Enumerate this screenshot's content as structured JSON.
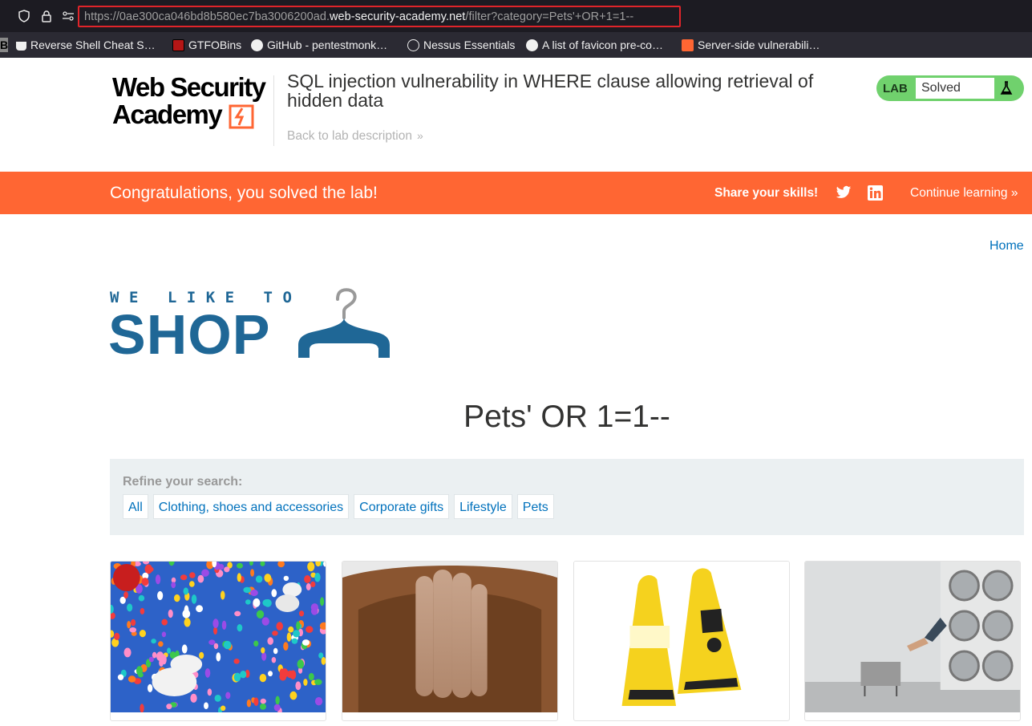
{
  "browser": {
    "url_prefix": "https://0ae300ca046bd8b580ec7ba3006200ad.",
    "url_host": "web-security-academy.net",
    "url_path": "/filter?category=Pets'+OR+1=1--",
    "bookmarks": [
      {
        "label": "Reverse Shell Cheat S…",
        "icon": "coffee-icon"
      },
      {
        "label": "GTFOBins",
        "icon": "gtfobins-icon"
      },
      {
        "label": "GitHub - pentestmonk…",
        "icon": "github-icon"
      },
      {
        "label": "Nessus Essentials",
        "icon": "globe-icon"
      },
      {
        "label": "A list of favicon pre-co…",
        "icon": "github-icon"
      },
      {
        "label": "Server-side vulnerabili…",
        "icon": "portswigger-icon"
      }
    ]
  },
  "lab": {
    "logo_line1": "Web Security",
    "logo_line2": "Academy",
    "title": "SQL injection vulnerability in WHERE clause allowing retrieval of hidden data",
    "back_link": "Back to lab description",
    "status_label": "LAB",
    "status_value": "Solved"
  },
  "banner": {
    "message": "Congratulations, you solved the lab!",
    "share_label": "Share your skills!",
    "continue_label": "Continue learning"
  },
  "shop": {
    "home_link": "Home",
    "logo_tagline": "WE LIKE TO",
    "logo_word": "SHOP",
    "heading": "Pets' OR 1=1--",
    "refine_label": "Refine your search:",
    "filters": [
      "All",
      "Clothing, shoes and accessories",
      "Corporate gifts",
      "Lifestyle",
      "Pets"
    ]
  },
  "colors": {
    "banner": "#ff6633",
    "lab_green": "#70d16d",
    "link_blue": "#0071bc",
    "shop_blue": "#1f6796",
    "url_highlight": "#e0242a"
  }
}
